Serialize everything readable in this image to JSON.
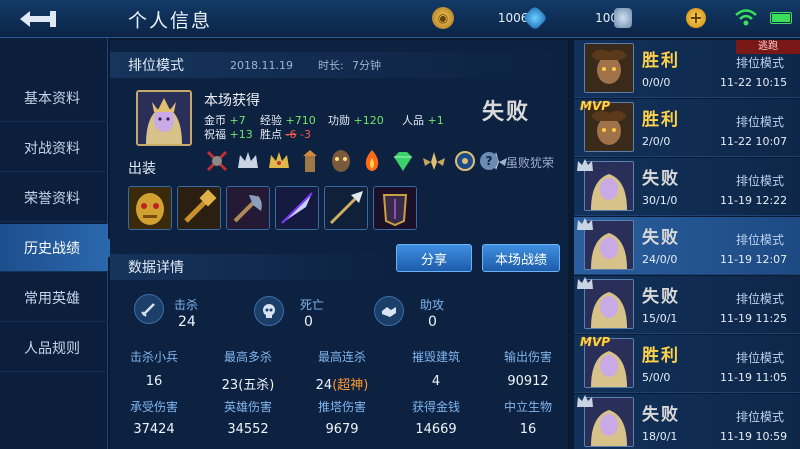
{
  "header": {
    "title": "个人信息",
    "gold": "10061",
    "gems": "100",
    "coupons": "0",
    "add": "+"
  },
  "sidebar": {
    "items": [
      {
        "label": "基本资料",
        "active": false
      },
      {
        "label": "对战资料",
        "active": false
      },
      {
        "label": "荣誉资料",
        "active": false
      },
      {
        "label": "历史战绩",
        "active": true
      },
      {
        "label": "常用英雄",
        "active": false
      },
      {
        "label": "人品规则",
        "active": false
      }
    ]
  },
  "match": {
    "mode": "排位模式",
    "date": "2018.11.19",
    "duration_label": "时长:",
    "duration": "7分钟",
    "rewards_title": "本场获得",
    "rewards": {
      "gold_label": "金币",
      "gold": "+7",
      "exp_label": "经验",
      "exp": "+710",
      "merit_label": "功勋",
      "merit": "+120",
      "rp_label": "人品",
      "rp": "+1",
      "blessing_label": "祝福",
      "blessing": "+13",
      "winpts_label": "胜点",
      "winpts_a": "-6",
      "winpts_b": "-3"
    },
    "result": "失败",
    "equip_label": "出装",
    "honor": "虽败犹荣",
    "help": "?",
    "share_label": "分享",
    "battle_label": "本场战绩"
  },
  "details": {
    "title": "数据详情",
    "kda": [
      {
        "label": "击杀",
        "value": "24",
        "icon": "sword-icon"
      },
      {
        "label": "死亡",
        "value": "0",
        "icon": "skull-icon"
      },
      {
        "label": "助攻",
        "value": "0",
        "icon": "handshake-icon"
      }
    ],
    "grid": [
      {
        "label": "击杀小兵",
        "value": "16"
      },
      {
        "label": "最高多杀",
        "value": "23(五杀)"
      },
      {
        "label": "最高连杀",
        "value": "24",
        "extra": "(超神)"
      },
      {
        "label": "摧毁建筑",
        "value": "4"
      },
      {
        "label": "输出伤害",
        "value": "90912"
      },
      {
        "label": "承受伤害",
        "value": "37424"
      },
      {
        "label": "英雄伤害",
        "value": "34552"
      },
      {
        "label": "推塔伤害",
        "value": "9679"
      },
      {
        "label": "获得金钱",
        "value": "14669"
      },
      {
        "label": "中立生物",
        "value": "16"
      }
    ]
  },
  "history": [
    {
      "result": "胜利",
      "win": true,
      "mode": "排位模式",
      "kda": "0/0/0",
      "time": "11-22 10:15",
      "tag": "逃跑",
      "mvp": false,
      "crown": false
    },
    {
      "result": "胜利",
      "win": true,
      "mode": "排位模式",
      "kda": "2/0/0",
      "time": "11-22 10:07",
      "tag": "",
      "mvp": true,
      "crown": false
    },
    {
      "result": "失败",
      "win": false,
      "mode": "排位模式",
      "kda": "30/1/0",
      "time": "11-19 12:22",
      "tag": "",
      "mvp": false,
      "crown": true
    },
    {
      "result": "失败",
      "win": false,
      "mode": "排位模式",
      "kda": "24/0/0",
      "time": "11-19 12:07",
      "tag": "",
      "mvp": false,
      "crown": true,
      "active": true
    },
    {
      "result": "失败",
      "win": false,
      "mode": "排位模式",
      "kda": "15/0/1",
      "time": "11-19 11:25",
      "tag": "",
      "mvp": false,
      "crown": true
    },
    {
      "result": "胜利",
      "win": true,
      "mode": "排位模式",
      "kda": "5/0/0",
      "time": "11-19 11:05",
      "tag": "",
      "mvp": true,
      "crown": false
    },
    {
      "result": "失败",
      "win": false,
      "mode": "排位模式",
      "kda": "18/0/1",
      "time": "11-19 10:59",
      "tag": "",
      "mvp": false,
      "crown": true
    }
  ],
  "colors": {
    "accent": "#2b67ad",
    "win": "#ffd24a",
    "gain": "#74e46a",
    "loss": "#ff5a4a"
  }
}
